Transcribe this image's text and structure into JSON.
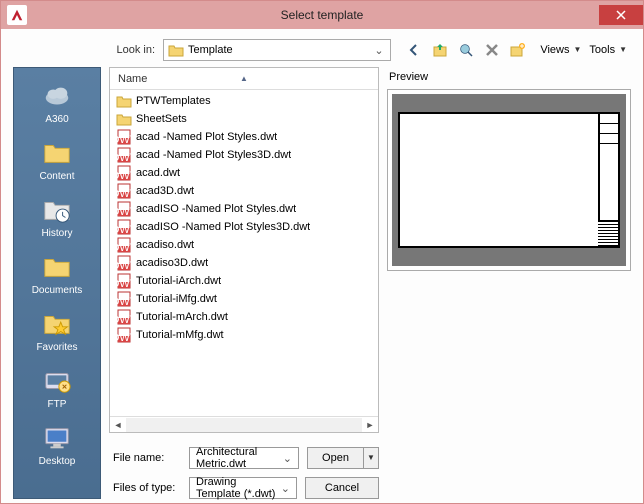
{
  "titlebar": {
    "title": "Select template"
  },
  "lookin": {
    "label": "Look in:",
    "value": "Template"
  },
  "toolbar": {
    "views": "Views",
    "tools": "Tools"
  },
  "places": [
    {
      "label": "A360",
      "icon": "cloud"
    },
    {
      "label": "Content",
      "icon": "folder"
    },
    {
      "label": "History",
      "icon": "history"
    },
    {
      "label": "Documents",
      "icon": "folder"
    },
    {
      "label": "Favorites",
      "icon": "favorites"
    },
    {
      "label": "FTP",
      "icon": "ftp"
    },
    {
      "label": "Desktop",
      "icon": "desktop"
    }
  ],
  "list": {
    "columns": {
      "name": "Name"
    },
    "items": [
      {
        "name": "PTWTemplates",
        "type": "folder"
      },
      {
        "name": "SheetSets",
        "type": "folder"
      },
      {
        "name": "acad -Named Plot Styles.dwt",
        "type": "dwt"
      },
      {
        "name": "acad -Named Plot Styles3D.dwt",
        "type": "dwt"
      },
      {
        "name": "acad.dwt",
        "type": "dwt"
      },
      {
        "name": "acad3D.dwt",
        "type": "dwt"
      },
      {
        "name": "acadISO -Named Plot Styles.dwt",
        "type": "dwt"
      },
      {
        "name": "acadISO -Named Plot Styles3D.dwt",
        "type": "dwt"
      },
      {
        "name": "acadiso.dwt",
        "type": "dwt"
      },
      {
        "name": "acadiso3D.dwt",
        "type": "dwt"
      },
      {
        "name": "Tutorial-iArch.dwt",
        "type": "dwt"
      },
      {
        "name": "Tutorial-iMfg.dwt",
        "type": "dwt"
      },
      {
        "name": "Tutorial-mArch.dwt",
        "type": "dwt"
      },
      {
        "name": "Tutorial-mMfg.dwt",
        "type": "dwt"
      }
    ]
  },
  "preview": {
    "label": "Preview"
  },
  "filename": {
    "label": "File name:",
    "value": "Architectural Metric.dwt"
  },
  "filetype": {
    "label": "Files of type:",
    "value": "Drawing Template (*.dwt)"
  },
  "buttons": {
    "open": "Open",
    "cancel": "Cancel"
  }
}
